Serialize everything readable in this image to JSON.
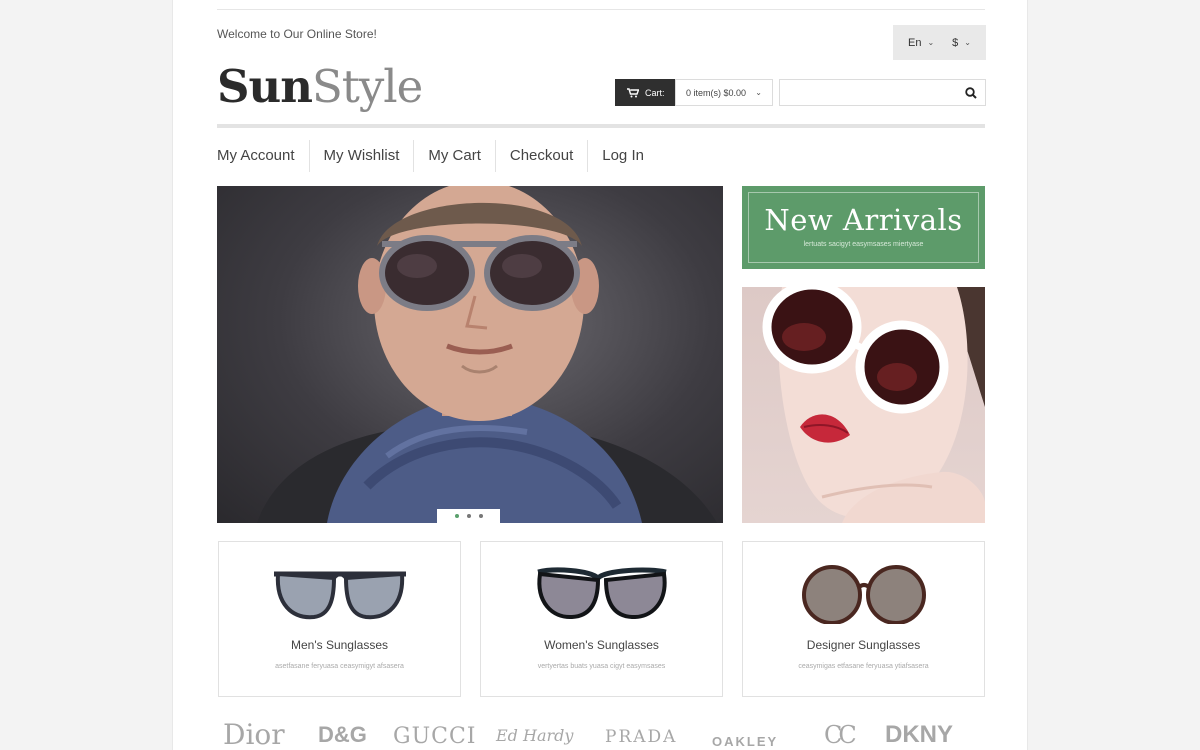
{
  "header": {
    "welcome": "Welcome to Our Online Store!",
    "language": "En",
    "currency": "$",
    "logo_part1": "Sun",
    "logo_part2": "Style"
  },
  "cart": {
    "label": "Cart:",
    "summary": "0 item(s) $0.00"
  },
  "search": {
    "placeholder": ""
  },
  "nav": {
    "items": [
      "My Account",
      "My Wishlist",
      "My Cart",
      "Checkout",
      "Log In"
    ]
  },
  "banner": {
    "title": "New Arrivals",
    "subtitle": "lertuats sacigyt easymsases miertyase"
  },
  "slider": {
    "slide_count": 3,
    "active_slide": 1
  },
  "categories": [
    {
      "name": "Men's Sunglasses",
      "desc": "asetfasane feryuasa ceasymigyt afsasera"
    },
    {
      "name": "Women's Sunglasses",
      "desc": "vertyertas buats yuasa cigyt easymsases"
    },
    {
      "name": "Designer Sunglasses",
      "desc": "ceasymigas etfasane feryuasa ytiafsasera"
    }
  ],
  "brands": [
    "Dior",
    "D&G",
    "GUCCI",
    "Ed Hardy",
    "PRADA",
    "OAKLEY",
    "CC",
    "DKNY"
  ],
  "colors": {
    "accent_green": "#5d9b6a",
    "dark": "#2f2f2f",
    "background": "#f3f3f3"
  }
}
